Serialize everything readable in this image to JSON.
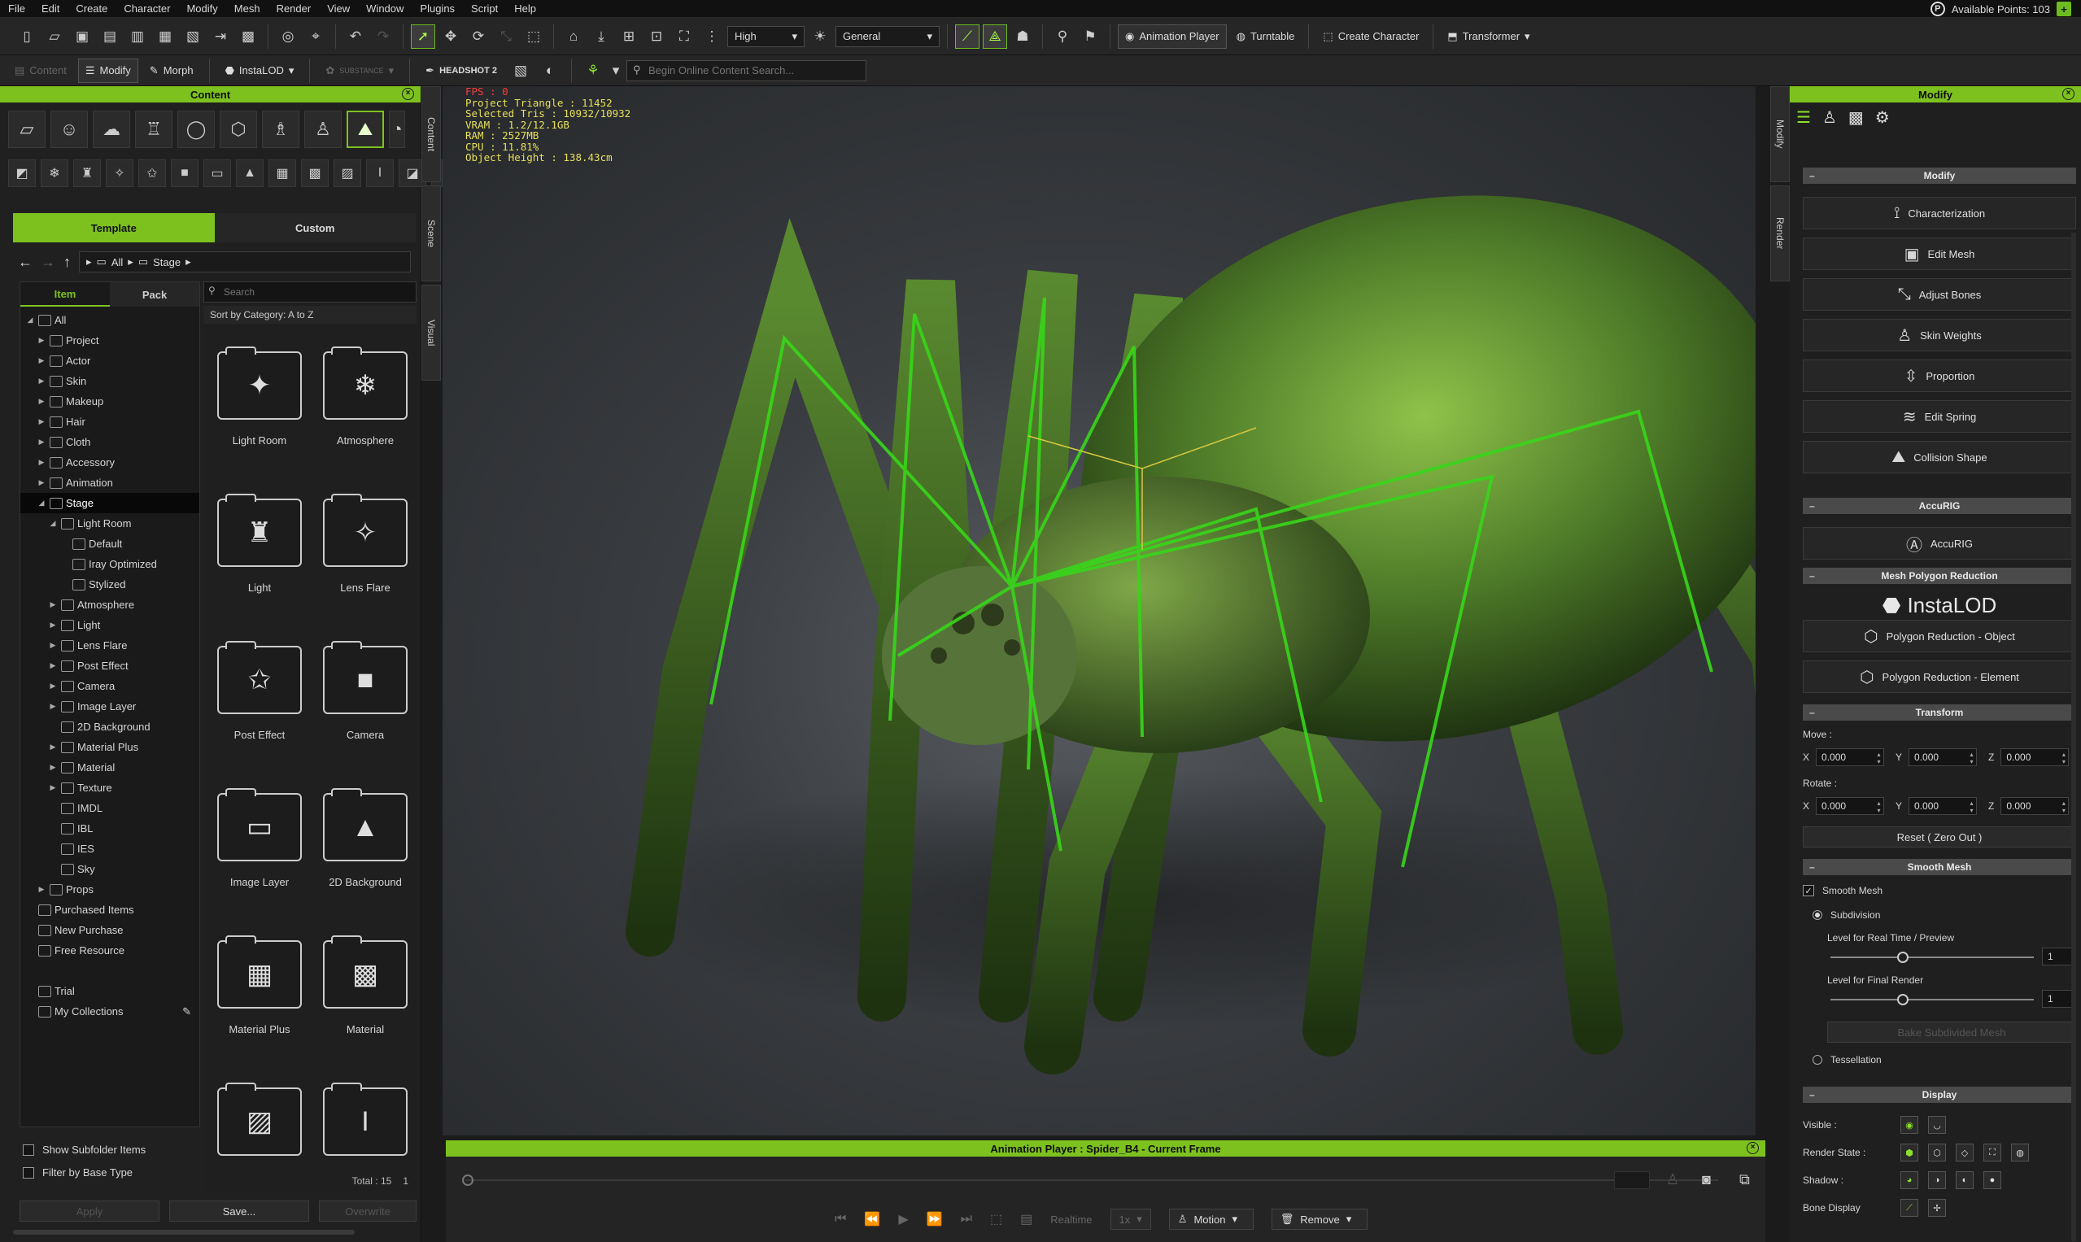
{
  "menu": [
    "File",
    "Edit",
    "Create",
    "Character",
    "Modify",
    "Mesh",
    "Render",
    "View",
    "Window",
    "Plugins",
    "Script",
    "Help"
  ],
  "points": {
    "label": "Available Points: 103",
    "badge": "P",
    "plus": "+"
  },
  "toolbar1": {
    "quality": "High",
    "shading": "General",
    "animation_player": "Animation Player",
    "turntable": "Turntable",
    "create_character": "Create Character",
    "transformer": "Transformer"
  },
  "toolbar2": {
    "content": "Content",
    "modify": "Modify",
    "morph": "Morph",
    "instalod": "InstaLOD",
    "substance": "SUBSTANCE",
    "headshot": "HEADSHOT 2",
    "search_placeholder": "Begin Online Content Search..."
  },
  "content_panel": {
    "title": "Content",
    "tabs": [
      "Template",
      "Custom"
    ],
    "crumbs": [
      "All",
      "Stage"
    ],
    "item_tab": "Item",
    "pack_tab": "Pack",
    "search_placeholder": "Search",
    "sort_label": "Sort by Category: A to Z",
    "tree": [
      {
        "label": "All",
        "level": 0,
        "arrow": "◢"
      },
      {
        "label": "Project",
        "level": 1,
        "arrow": "▶"
      },
      {
        "label": "Actor",
        "level": 1,
        "arrow": "▶"
      },
      {
        "label": "Skin",
        "level": 1,
        "arrow": "▶"
      },
      {
        "label": "Makeup",
        "level": 1,
        "arrow": "▶"
      },
      {
        "label": "Hair",
        "level": 1,
        "arrow": "▶"
      },
      {
        "label": "Cloth",
        "level": 1,
        "arrow": "▶"
      },
      {
        "label": "Accessory",
        "level": 1,
        "arrow": "▶"
      },
      {
        "label": "Animation",
        "level": 1,
        "arrow": "▶"
      },
      {
        "label": "Stage",
        "level": 1,
        "arrow": "◢",
        "selected": true
      },
      {
        "label": "Light Room",
        "level": 2,
        "arrow": "◢"
      },
      {
        "label": "Default",
        "level": 3,
        "arrow": ""
      },
      {
        "label": "Iray Optimized",
        "level": 3,
        "arrow": ""
      },
      {
        "label": "Stylized",
        "level": 3,
        "arrow": ""
      },
      {
        "label": "Atmosphere",
        "level": 2,
        "arrow": "▶"
      },
      {
        "label": "Light",
        "level": 2,
        "arrow": "▶"
      },
      {
        "label": "Lens Flare",
        "level": 2,
        "arrow": "▶"
      },
      {
        "label": "Post Effect",
        "level": 2,
        "arrow": "▶"
      },
      {
        "label": "Camera",
        "level": 2,
        "arrow": "▶"
      },
      {
        "label": "Image Layer",
        "level": 2,
        "arrow": "▶"
      },
      {
        "label": "2D Background",
        "level": 2,
        "arrow": ""
      },
      {
        "label": "Material Plus",
        "level": 2,
        "arrow": "▶"
      },
      {
        "label": "Material",
        "level": 2,
        "arrow": "▶"
      },
      {
        "label": "Texture",
        "level": 2,
        "arrow": "▶"
      },
      {
        "label": "IMDL",
        "level": 2,
        "arrow": ""
      },
      {
        "label": "IBL",
        "level": 2,
        "arrow": ""
      },
      {
        "label": "IES",
        "level": 2,
        "arrow": ""
      },
      {
        "label": "Sky",
        "level": 2,
        "arrow": ""
      },
      {
        "label": "Props",
        "level": 1,
        "arrow": "▶"
      },
      {
        "label": "Purchased Items",
        "level": 0,
        "arrow": ""
      },
      {
        "label": "New Purchase",
        "level": 0,
        "arrow": ""
      },
      {
        "label": "Free Resource",
        "level": 0,
        "arrow": ""
      },
      {
        "label": "",
        "level": 0,
        "arrow": ""
      },
      {
        "label": "Trial",
        "level": 0,
        "arrow": ""
      },
      {
        "label": "My Collections",
        "level": 0,
        "arrow": ""
      }
    ],
    "grid": [
      {
        "label": "Light Room",
        "glyph": "✦"
      },
      {
        "label": "Atmosphere",
        "glyph": "❄"
      },
      {
        "label": "Light",
        "glyph": "♜"
      },
      {
        "label": "Lens Flare",
        "glyph": "✧"
      },
      {
        "label": "Post Effect",
        "glyph": "✩"
      },
      {
        "label": "Camera",
        "glyph": "■"
      },
      {
        "label": "Image Layer",
        "glyph": "▭"
      },
      {
        "label": "2D Background",
        "glyph": "▲"
      },
      {
        "label": "Material Plus",
        "glyph": "▦"
      },
      {
        "label": "Material",
        "glyph": "▩"
      },
      {
        "label": "",
        "glyph": "▨"
      },
      {
        "label": "",
        "glyph": "I"
      }
    ],
    "total": "Total : 15",
    "page": "1",
    "show_subfolder": "Show Subfolder Items",
    "filter_base": "Filter by Base Type",
    "apply": "Apply",
    "save": "Save...",
    "overwrite": "Overwrite"
  },
  "side_tabs": {
    "content": "Content",
    "scene": "Scene",
    "visual": "Visual",
    "modify": "Modify",
    "render": "Render"
  },
  "stats": {
    "fps": "FPS : 0",
    "lines": [
      "Project Triangle : 11452",
      "Selected Tris : 10932/10932",
      "VRAM : 1.2/12.1GB",
      "RAM : 2527MB",
      "CPU : 11.81%",
      "Object Height : 138.43cm"
    ]
  },
  "anim_player": {
    "title": "Animation Player : Spider_B4 - Current Frame",
    "realtime": "Realtime",
    "speed": "1x",
    "motion": "Motion",
    "remove": "Remove"
  },
  "modify_panel": {
    "title": "Modify",
    "modify_head": "Modify",
    "buttons": [
      "Characterization",
      "Edit Mesh",
      "Adjust Bones",
      "Skin Weights",
      "Proportion",
      "Edit Spring",
      "Collision Shape"
    ],
    "accurig_head": "AccuRIG",
    "accurig": "AccuRIG",
    "mpr_head": "Mesh Polygon Reduction",
    "instalod": "InstaLOD",
    "poly_object": "Polygon Reduction - Object",
    "poly_element": "Polygon Reduction - Element",
    "transform_head": "Transform",
    "move_label": "Move :",
    "rotate_label": "Rotate :",
    "move": {
      "x": "0.000",
      "y": "0.000",
      "z": "0.000"
    },
    "rotate": {
      "x": "0.000",
      "y": "0.000",
      "z": "0.000"
    },
    "axis": {
      "x": "X",
      "y": "Y",
      "z": "Z"
    },
    "reset": "Reset ( Zero Out )",
    "smooth_head": "Smooth Mesh",
    "smooth_mesh": "Smooth Mesh",
    "subdivision": "Subdivision",
    "level_rt": "Level for Real Time / Preview",
    "level_rt_value": "1",
    "level_fr": "Level for Final Render",
    "level_fr_value": "1",
    "bake": "Bake Subdivided Mesh",
    "tessellation": "Tessellation",
    "display_head": "Display",
    "visible": "Visible :",
    "render_state": "Render State :",
    "shadow": "Shadow :",
    "bone_display": "Bone Display"
  },
  "colors": {
    "accent": "#7dc11f",
    "panel": "#202020",
    "viewport": "#3a3d41",
    "bone": "#38d61a",
    "stats": "#e6e05a"
  }
}
